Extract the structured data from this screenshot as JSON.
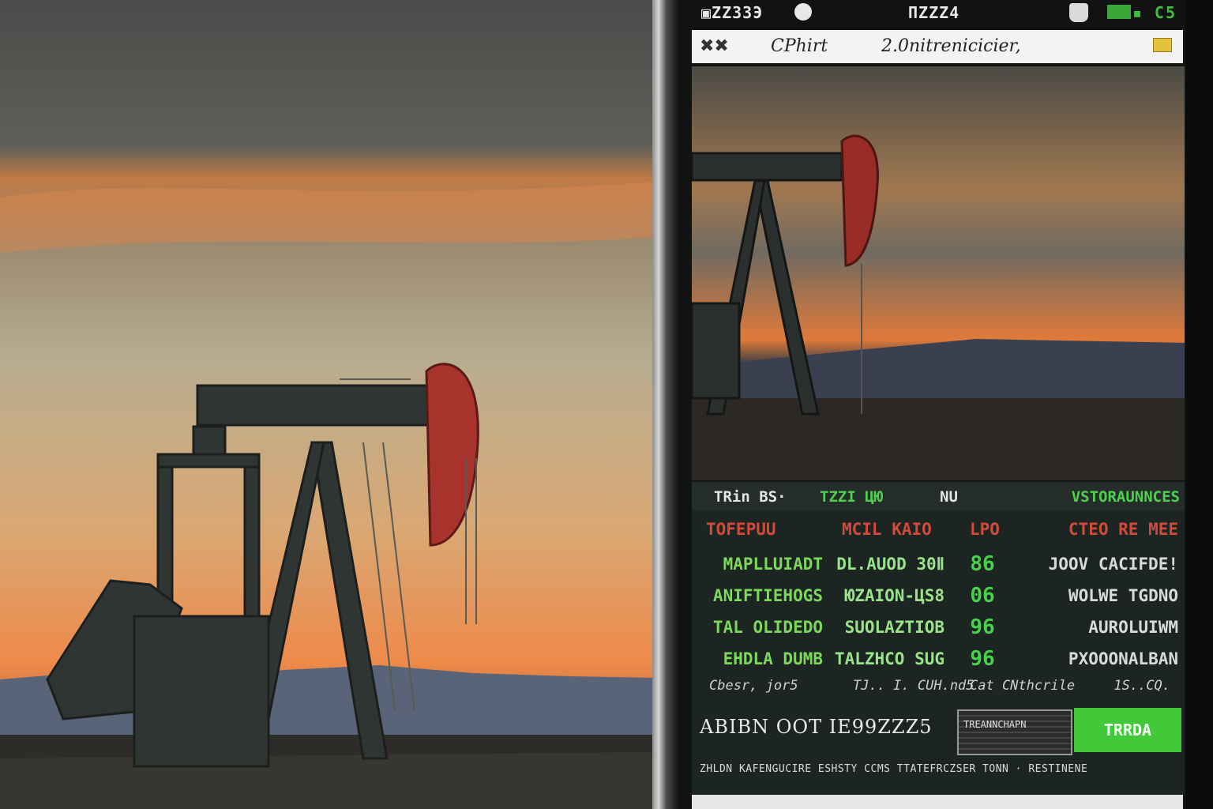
{
  "status_bar": {
    "left_text": "▣ZZЗ3Э",
    "center_text": "ΠZZZ4",
    "right_text": "▪ C5"
  },
  "app_header": {
    "menu_glyph": "✖✖",
    "title": "CPhirt",
    "date": "2.0nitrenicicier,"
  },
  "panel": {
    "tabs": [
      "TRin BS·",
      "TZZI ЦЮ",
      "NU",
      "VSTORAUNNCES"
    ],
    "column_headers": [
      "TOFEPUU",
      "MCIL KAIO",
      "LPO",
      "CTEO RE MEE"
    ],
    "rows": [
      {
        "name": "MAPLLUIADT",
        "volume": "DL.AUOD 30Ⅱ",
        "change": "86",
        "desc": "JOOV CACIFDE!"
      },
      {
        "name": "ANIFTIEHOGS",
        "volume": "ЮZAION-ЦS8",
        "change": "06",
        "desc": "WOLWE TGDNO"
      },
      {
        "name": "TAL OLIDEDO",
        "volume": "SUOLAZTIOB",
        "change": "96",
        "desc": "AUROLUIWM"
      },
      {
        "name": "EHDLA DUMB",
        "volume": "TALZHCO SUG",
        "change": "96",
        "desc": "PXOOONALBAN"
      }
    ],
    "footnotes": [
      "Cbesr, jor5",
      "TJ.. I. CUH.nd5",
      "Cat CNthcrile",
      "1S..CQ."
    ],
    "total_label": "ABIBN  OOT  IE99ZZZ5",
    "ticker_caption": "TREANNCHAPN",
    "trade_label": "TRRDA",
    "disclaimer": "ZHLDN  KAFENGUCIRE ESHSTY CCMS  TTATEFRCZSER TONN · RESTINENE"
  },
  "colors": {
    "accent_green": "#41c93a",
    "header_red": "#d24a3a",
    "panel_bg": "#1d2522"
  },
  "icons": [
    "menu-icon",
    "user-icon",
    "signal-icon",
    "flag-icon",
    "oil-pumpjack-illustration"
  ]
}
